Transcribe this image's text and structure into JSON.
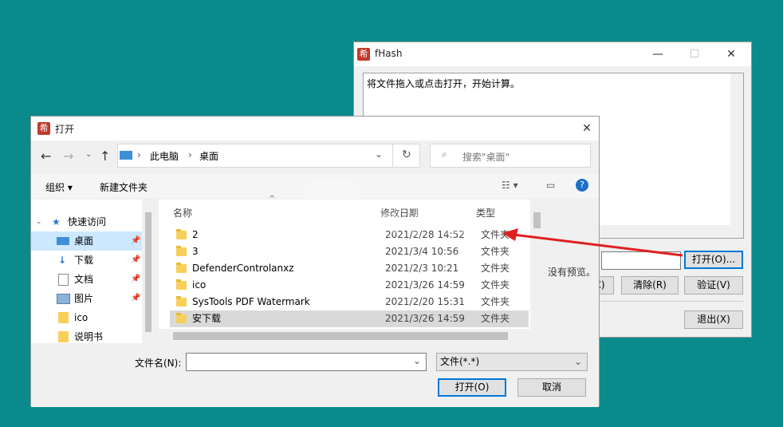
{
  "fhash": {
    "title": "fHash",
    "instructions": "将文件拖入或点击打开，开始计算。",
    "no_preview": "没有预览。",
    "buttons": {
      "open": "打开(O)...",
      "clear": "清除(R)",
      "verify": "验证(V)",
      "exit": "退出(X)",
      "partial": "C)"
    }
  },
  "dialog": {
    "title": "打开",
    "breadcrumb": [
      "此电脑",
      "桌面"
    ],
    "search_placeholder": "搜索\"桌面\"",
    "toolbar": {
      "organize": "组织 ▾",
      "new_folder": "新建文件夹"
    },
    "nav": [
      {
        "label": "快速访问",
        "icon": "star-icon"
      },
      {
        "label": "桌面",
        "icon": "desktop-icon"
      },
      {
        "label": "下载",
        "icon": "download-icon"
      },
      {
        "label": "文档",
        "icon": "document-icon"
      },
      {
        "label": "图片",
        "icon": "picture-icon"
      },
      {
        "label": "ico",
        "icon": "folder-icon"
      },
      {
        "label": "说明书",
        "icon": "folder-icon"
      }
    ],
    "columns": {
      "name": "名称",
      "date": "修改日期",
      "type": "类型"
    },
    "files": [
      {
        "name": "2",
        "date": "2021/2/28 14:52",
        "type": "文件夹"
      },
      {
        "name": "3",
        "date": "2021/3/4 10:56",
        "type": "文件夹"
      },
      {
        "name": "DefenderControlanxz",
        "date": "2021/2/3 10:21",
        "type": "文件夹"
      },
      {
        "name": "ico",
        "date": "2021/3/26 14:59",
        "type": "文件夹"
      },
      {
        "name": "SysTools PDF Watermark",
        "date": "2021/2/20 15:31",
        "type": "文件夹"
      },
      {
        "name": "安下载",
        "date": "2021/3/26 14:59",
        "type": "文件夹"
      }
    ],
    "filename_label": "文件名(N):",
    "filename_value": "",
    "filetype": "文件(*.*)",
    "open_button": "打开(O)",
    "cancel_button": "取消"
  },
  "watermark": "安下载",
  "colors": {
    "background": "#0a8a8a",
    "selection": "#cce8ff",
    "arrow": "#e02020"
  }
}
